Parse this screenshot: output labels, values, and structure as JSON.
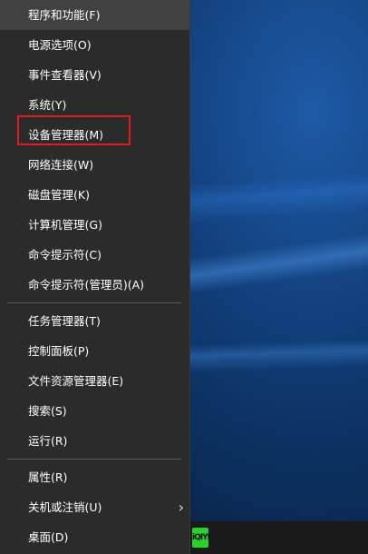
{
  "menu": {
    "items": [
      {
        "label": "程序和功能(F)"
      },
      {
        "label": "电源选项(O)"
      },
      {
        "label": "事件查看器(V)"
      },
      {
        "label": "系统(Y)"
      },
      {
        "label": "设备管理器(M)"
      },
      {
        "label": "网络连接(W)"
      },
      {
        "label": "磁盘管理(K)"
      },
      {
        "label": "计算机管理(G)"
      },
      {
        "label": "命令提示符(C)"
      },
      {
        "label": "命令提示符(管理员)(A)"
      },
      {
        "label": "任务管理器(T)"
      },
      {
        "label": "控制面板(P)"
      },
      {
        "label": "文件资源管理器(E)"
      },
      {
        "label": "搜索(S)"
      },
      {
        "label": "运行(R)"
      },
      {
        "label": "属性(R)"
      },
      {
        "label": "关机或注销(U)"
      },
      {
        "label": "桌面(D)"
      }
    ],
    "highlighted_item": "设备管理器(M)",
    "highlight_color": "#e31b1b"
  },
  "taskbar": {
    "app_icon_text": "iQIYI",
    "app_icon_color": "#2bd12b"
  },
  "icons": {
    "submenu_arrow": "chevron-right-icon"
  }
}
